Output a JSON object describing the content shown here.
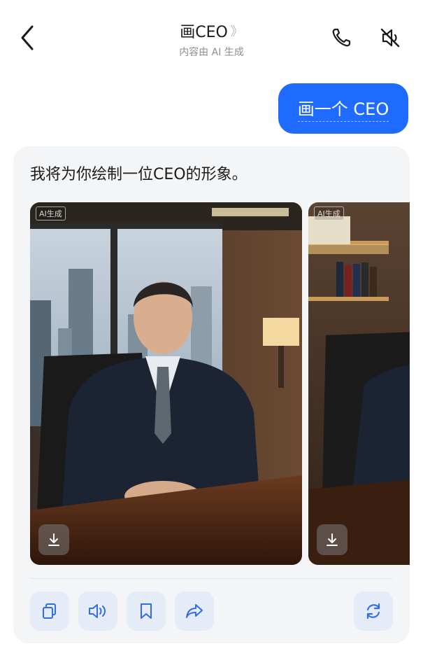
{
  "header": {
    "title": "画CEO",
    "title_chevron": "》",
    "subtitle": "内容由 AI 生成",
    "icons": [
      "back-arrow-icon",
      "phone-icon",
      "speaker-muted-icon"
    ]
  },
  "user_message": {
    "text": "画一个 CEO"
  },
  "assistant": {
    "text": "我将为你绘制一位CEO的形象。",
    "images": [
      {
        "tag": "AI生成",
        "download_icon": "download-icon"
      },
      {
        "tag": "AI生成",
        "download_icon": "download-icon"
      }
    ],
    "actions": [
      "copy-icon",
      "speaker-icon",
      "bookmark-icon",
      "share-icon",
      "regenerate-icon"
    ]
  },
  "colors": {
    "accent": "#1f6bff",
    "card_bg": "#f4f5f7",
    "action_bg": "#e6ecf7",
    "icon": "#2f6fe0"
  }
}
